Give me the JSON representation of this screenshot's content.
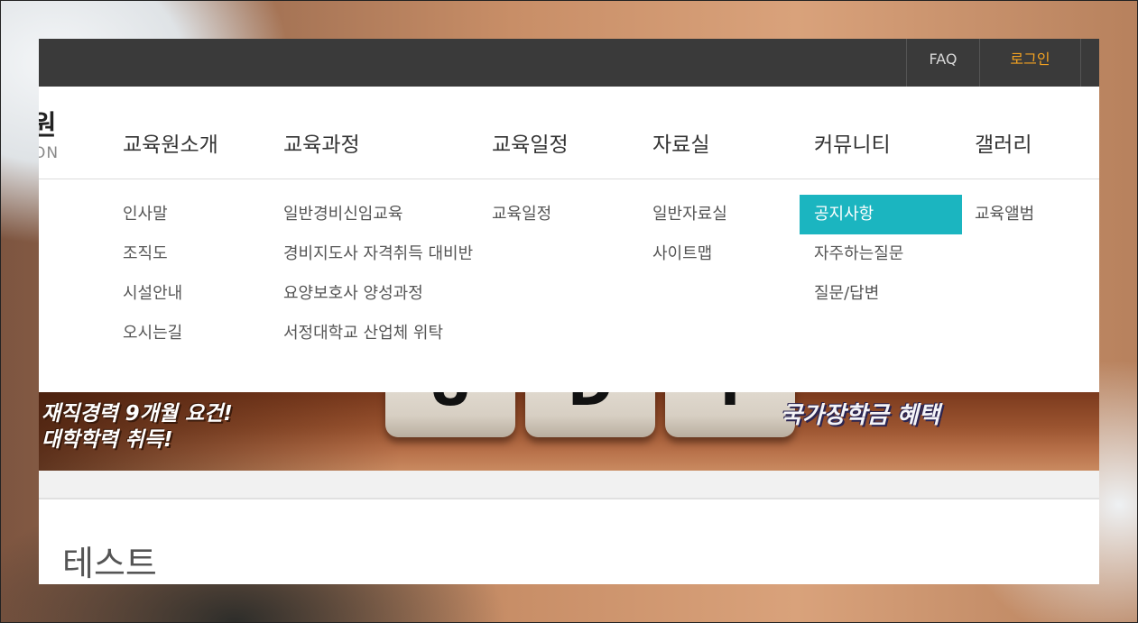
{
  "topbar": {
    "faq": "FAQ",
    "login": "로그인"
  },
  "logo": {
    "main": "원",
    "sub": "ON"
  },
  "nav": {
    "items": [
      {
        "label": "교육원소개",
        "sub": [
          "인사말",
          "조직도",
          "시설안내",
          "오시는길"
        ]
      },
      {
        "label": "교육과정",
        "sub": [
          "일반경비신임교육",
          "경비지도사 자격취득 대비반",
          "요양보호사 양성과정",
          "서정대학교 산업체 위탁"
        ]
      },
      {
        "label": "교육일정",
        "sub": [
          "교육일정"
        ]
      },
      {
        "label": "자료실",
        "sub": [
          "일반자료실",
          "사이트맵"
        ]
      },
      {
        "label": "커뮤니티",
        "sub": [
          "공지사항",
          "자주하는질문",
          "질문/답변"
        ]
      },
      {
        "label": "갤러리",
        "sub": [
          "교육앨범"
        ]
      }
    ],
    "active_sub": "공지사항",
    "active_color": "#1bb5c0"
  },
  "banner": {
    "line1": "재직경력 9개월 요건!",
    "line2": "대학학력 취득!",
    "right": "국가장학금 혜택",
    "blocks": [
      "U",
      "D",
      "Y"
    ]
  },
  "page": {
    "title": "테스트"
  },
  "colors": {
    "topbar": "#3a3a3a",
    "login": "#f4a321",
    "accent": "#1bb5c0"
  }
}
